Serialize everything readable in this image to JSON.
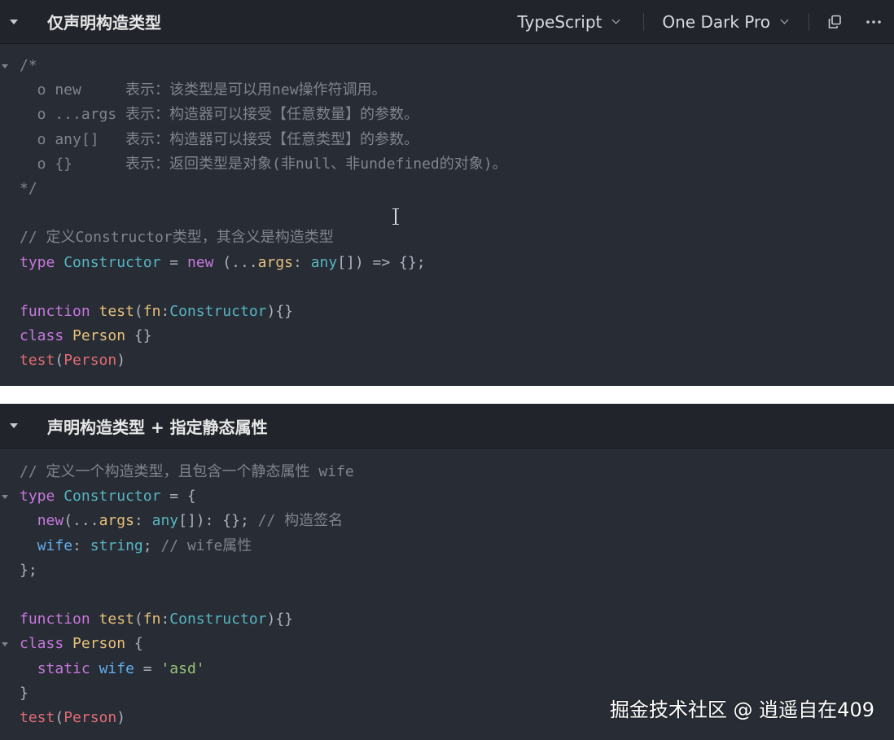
{
  "colors": {
    "background": "#282c34",
    "header_background": "#21252b",
    "comment": "#7f848e",
    "keyword": "#c678dd",
    "type": "#56b6c2",
    "function": "#e5c07b",
    "parameter": "#e06c75",
    "property": "#61afef",
    "string": "#98c379",
    "plain": "#abb2bf"
  },
  "block1": {
    "title": "仅声明构造类型",
    "language": "TypeScript",
    "theme": "One Dark Pro",
    "copy_icon": "copy-icon",
    "more_icon": "ellipsis-icon",
    "code": {
      "l1": "/*",
      "l2": "  o new     表示：该类型是可以用new操作符调用。",
      "l3": "  o ...args 表示：构造器可以接受【任意数量】的参数。",
      "l4": "  o any[]   表示：构造器可以接受【任意类型】的参数。",
      "l5": "  o {}      表示：返回类型是对象(非null、非undefined的对象)。",
      "l6": "*/",
      "l8": "// 定义Constructor类型，其含义是构造类型",
      "l9": {
        "t1": "type",
        "t2": " ",
        "t3": "Constructor",
        "t4": " = ",
        "t5": "new",
        "t6": " (...",
        "t7": "args",
        "t8": ": ",
        "t9": "any",
        "t10": "[]) => {};"
      },
      "l11": {
        "t1": "function",
        "t2": " ",
        "t3": "test",
        "t4": "(",
        "t5": "fn",
        "t6": ":",
        "t7": "Constructor",
        "t8": "){}"
      },
      "l12": {
        "t1": "class",
        "t2": " ",
        "t3": "Person",
        "t4": " {}"
      },
      "l13": {
        "t1": "test",
        "t2": "(",
        "t3": "Person",
        "t4": ")"
      }
    }
  },
  "block2": {
    "title": "声明构造类型 + 指定静态属性",
    "code": {
      "l1": "// 定义一个构造类型，且包含一个静态属性 wife",
      "l2": {
        "t1": "type",
        "t2": " ",
        "t3": "Constructor",
        "t4": " = {"
      },
      "l3": {
        "t0": "  ",
        "t1": "new",
        "t2": "(...",
        "t3": "args",
        "t4": ": ",
        "t5": "any",
        "t6": "[]): {}; ",
        "t7": "// 构造签名"
      },
      "l4": {
        "t0": "  ",
        "t1": "wife",
        "t2": ": ",
        "t3": "string",
        "t4": "; ",
        "t5": "// wife属性"
      },
      "l5": "};",
      "l7": {
        "t1": "function",
        "t2": " ",
        "t3": "test",
        "t4": "(",
        "t5": "fn",
        "t6": ":",
        "t7": "Constructor",
        "t8": "){}"
      },
      "l8": {
        "t1": "class",
        "t2": " ",
        "t3": "Person",
        "t4": " {"
      },
      "l9": {
        "t0": "  ",
        "t1": "static",
        "t2": " ",
        "t3": "wife",
        "t4": " = ",
        "t5": "'asd'"
      },
      "l10": "}",
      "l11": {
        "t1": "test",
        "t2": "(",
        "t3": "Person",
        "t4": ")"
      }
    }
  },
  "watermark": "掘金技术社区 @ 逍遥自在409"
}
